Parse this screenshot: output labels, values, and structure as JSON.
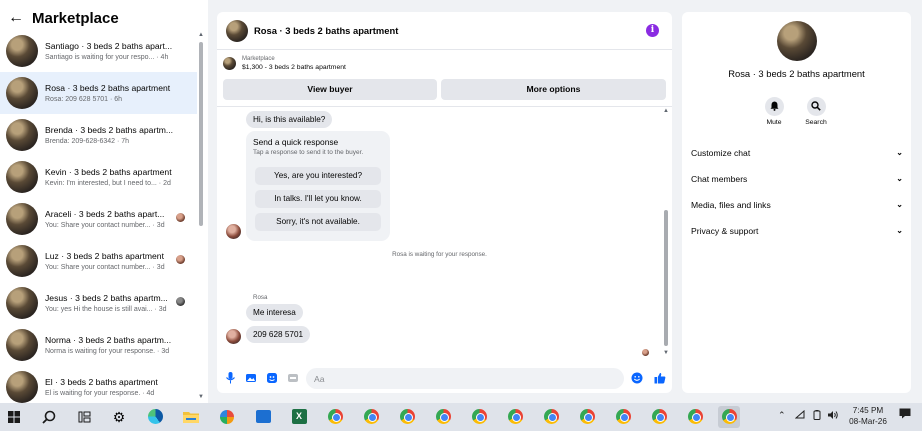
{
  "sidebar": {
    "back_icon": "arrow-left-icon",
    "title": "Marketplace",
    "conversations": [
      {
        "name": "Santiago · 3 beds 2 baths apart...",
        "preview": "Santiago is waiting for your respo... · 4h"
      },
      {
        "name": "Rosa · 3 beds 2 baths apartment",
        "preview": "Rosa: 209 628 5701 · 6h"
      },
      {
        "name": "Brenda · 3 beds 2 baths apartm...",
        "preview": "Brenda: 209-628-6342 · 7h"
      },
      {
        "name": "Kevin · 3 beds 2 baths apartment",
        "preview": "Kevin: I'm interested, but I need to... · 2d"
      },
      {
        "name": "Araceli · 3 beds 2 baths apart...",
        "preview": "You: Share your contact number... · 3d"
      },
      {
        "name": "Luz · 3 beds 2 baths apartment",
        "preview": "You: Share your contact number... · 3d"
      },
      {
        "name": "Jesus · 3 beds 2 baths apartm...",
        "preview": "You: yes Hi the house is still avai... · 3d"
      },
      {
        "name": "Norma · 3 beds 2 baths apartm...",
        "preview": "Norma is waiting for your response. · 3d"
      },
      {
        "name": "El · 3 beds 2 baths apartment",
        "preview": "El is waiting for your response. · 4d"
      }
    ]
  },
  "chat": {
    "title": "Rosa · 3 beds 2 baths apartment",
    "listing_source": "Marketplace",
    "listing_price": "$1,300 - 3 beds 2 baths apartment",
    "view_buyer": "View buyer",
    "more_options": "More options",
    "first_message": "Hi, is this available?",
    "quick_title": "Send a quick response",
    "quick_subtitle": "Tap a response to send it to the buyer.",
    "quick_options": [
      "Yes, are you interested?",
      "In talks. I'll let you know.",
      "Sorry, it's not available."
    ],
    "status_note": "Rosa is waiting for your response.",
    "sender_label": "Rosa",
    "message_2": "Me interesa",
    "message_3": "209 628 5701",
    "input_placeholder": "Aa"
  },
  "details": {
    "title": "Rosa · 3 beds 2 baths apartment",
    "mute_label": "Mute",
    "search_label": "Search",
    "rows": [
      "Customize chat",
      "Chat members",
      "Media, files and links",
      "Privacy & support"
    ]
  },
  "taskbar": {
    "time": "7:45 PM",
    "date": "08-Mar-26"
  },
  "colors": {
    "accent": "#0a66ff",
    "active_row": "#e7f0fc",
    "info_purple": "#8a2be2"
  }
}
